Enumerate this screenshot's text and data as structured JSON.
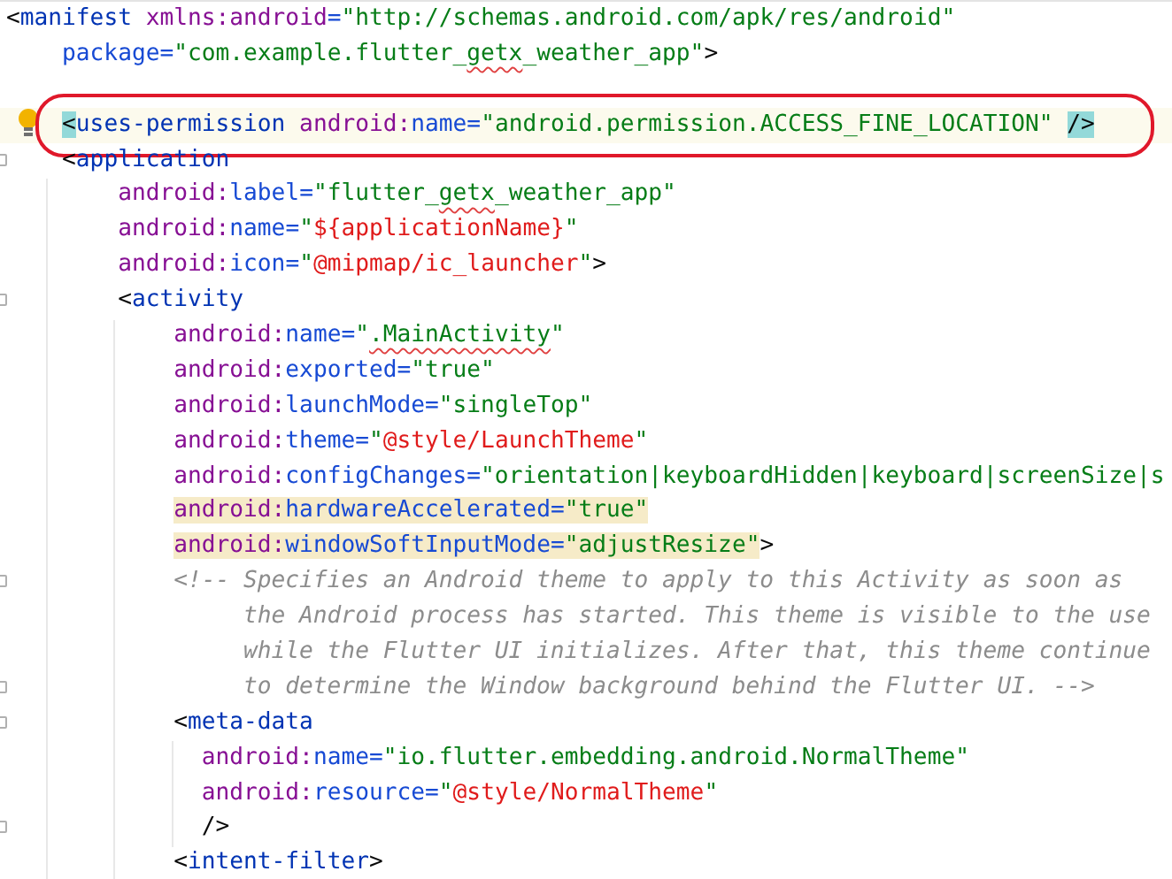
{
  "editor": {
    "lines": [
      {
        "tokens": [
          {
            "text": "<",
            "kind": "p"
          },
          {
            "text": "manifest",
            "kind": "tag"
          },
          {
            "text": " xmlns:android",
            "kind": "ns"
          },
          {
            "text": "=",
            "kind": "attr"
          },
          {
            "text": "\"http://schemas.android.com/apk/res/android\"",
            "kind": "val"
          }
        ],
        "fold": false,
        "current": false,
        "highlighted": false,
        "bulb": false,
        "circled": false
      },
      {
        "tokens": [
          {
            "text": "    package",
            "kind": "attr"
          },
          {
            "text": "=",
            "kind": "attr"
          },
          {
            "text": "\"com.example.flutter_",
            "kind": "val"
          },
          {
            "text": "getx",
            "kind": "typo"
          },
          {
            "text": "_weather_app\"",
            "kind": "val"
          },
          {
            "text": ">",
            "kind": "p"
          }
        ],
        "fold": false,
        "current": false,
        "highlighted": false,
        "bulb": false,
        "circled": false
      },
      {
        "current": false,
        "highlighted": false
      },
      {
        "tokens": [
          {
            "text": "    <",
            "kind": "match"
          },
          {
            "text": "uses-permission",
            "kind": "tag"
          },
          {
            "text": " android:",
            "kind": "ns"
          },
          {
            "text": "name",
            "kind": "attr"
          },
          {
            "text": "=",
            "kind": "attr"
          },
          {
            "text": "\"android.permission.ACCESS_FINE_LOCATION\" ",
            "kind": "val"
          },
          {
            "text": "/>",
            "kind": "match"
          }
        ],
        "fold": false,
        "current": true,
        "highlighted": false,
        "bulb": true,
        "circled": true
      },
      {
        "tokens": [
          {
            "text": "    <",
            "kind": "p"
          },
          {
            "text": "application",
            "kind": "tag"
          }
        ],
        "fold": true,
        "current": false,
        "highlighted": false,
        "bulb": false,
        "circled": false
      },
      {
        "tokens": [
          {
            "text": "        android:",
            "kind": "ns"
          },
          {
            "text": "label",
            "kind": "attr"
          },
          {
            "text": "=",
            "kind": "attr"
          },
          {
            "text": "\"flutter_",
            "kind": "val"
          },
          {
            "text": "getx",
            "kind": "typo"
          },
          {
            "text": "_weather_app\"",
            "kind": "val"
          }
        ],
        "fold": false,
        "current": false,
        "highlighted": false,
        "bulb": false,
        "circled": false
      },
      {
        "tokens": [
          {
            "text": "        android:",
            "kind": "ns"
          },
          {
            "text": "name",
            "kind": "attr"
          },
          {
            "text": "=",
            "kind": "attr"
          },
          {
            "text": "\"",
            "kind": "val"
          },
          {
            "text": "${applicationName}",
            "kind": "ref"
          },
          {
            "text": "\"",
            "kind": "val"
          }
        ],
        "fold": false,
        "current": false,
        "highlighted": false,
        "bulb": false,
        "circled": false
      },
      {
        "tokens": [
          {
            "text": "        android:",
            "kind": "ns"
          },
          {
            "text": "icon",
            "kind": "attr"
          },
          {
            "text": "=",
            "kind": "attr"
          },
          {
            "text": "\"",
            "kind": "val"
          },
          {
            "text": "@mipmap/ic_launcher",
            "kind": "ref"
          },
          {
            "text": "\"",
            "kind": "val"
          },
          {
            "text": ">",
            "kind": "p"
          }
        ],
        "fold": false,
        "current": false,
        "highlighted": false,
        "bulb": false,
        "circled": false
      },
      {
        "tokens": [
          {
            "text": "        <",
            "kind": "p"
          },
          {
            "text": "activity",
            "kind": "tag"
          }
        ],
        "fold": true,
        "current": false,
        "highlighted": false,
        "bulb": false,
        "circled": false
      },
      {
        "tokens": [
          {
            "text": "            android:",
            "kind": "ns"
          },
          {
            "text": "name",
            "kind": "attr"
          },
          {
            "text": "=",
            "kind": "attr"
          },
          {
            "text": "\"",
            "kind": "val"
          },
          {
            "text": ".MainActivity",
            "kind": "typo"
          },
          {
            "text": "\"",
            "kind": "val"
          }
        ],
        "fold": false,
        "current": false,
        "highlighted": false,
        "bulb": false,
        "circled": false
      },
      {
        "tokens": [
          {
            "text": "            android:",
            "kind": "ns"
          },
          {
            "text": "exported",
            "kind": "attr"
          },
          {
            "text": "=",
            "kind": "attr"
          },
          {
            "text": "\"true\"",
            "kind": "val"
          }
        ],
        "fold": false,
        "current": false,
        "highlighted": false,
        "bulb": false,
        "circled": false
      },
      {
        "tokens": [
          {
            "text": "            android:",
            "kind": "ns"
          },
          {
            "text": "launchMode",
            "kind": "attr"
          },
          {
            "text": "=",
            "kind": "attr"
          },
          {
            "text": "\"singleTop\"",
            "kind": "val"
          }
        ],
        "fold": false,
        "current": false,
        "highlighted": false,
        "bulb": false,
        "circled": false
      },
      {
        "tokens": [
          {
            "text": "            android:",
            "kind": "ns"
          },
          {
            "text": "theme",
            "kind": "attr"
          },
          {
            "text": "=",
            "kind": "attr"
          },
          {
            "text": "\"",
            "kind": "val"
          },
          {
            "text": "@style/LaunchTheme",
            "kind": "ref"
          },
          {
            "text": "\"",
            "kind": "val"
          }
        ],
        "fold": false,
        "current": false,
        "highlighted": false,
        "bulb": false,
        "circled": false
      },
      {
        "tokens": [
          {
            "text": "            android:",
            "kind": "ns"
          },
          {
            "text": "configChanges",
            "kind": "attr"
          },
          {
            "text": "=",
            "kind": "attr"
          },
          {
            "text": "\"orientation|keyboardHidden|keyboard|screenSize|s",
            "kind": "val"
          }
        ],
        "fold": false,
        "current": false,
        "highlighted": false,
        "bulb": false,
        "circled": false
      },
      {
        "tokens": [
          {
            "text": "            android:",
            "kind": "ns"
          },
          {
            "text": "hardwareAccelerated",
            "kind": "attr"
          },
          {
            "text": "=",
            "kind": "attr"
          },
          {
            "text": "\"true\"",
            "kind": "val"
          }
        ],
        "fold": false,
        "current": false,
        "highlighted": true,
        "bulb": false,
        "circled": false
      },
      {
        "tokens": [
          {
            "text": "            android:",
            "kind": "ns"
          },
          {
            "text": "windowSoftInputMode",
            "kind": "attr"
          },
          {
            "text": "=",
            "kind": "attr"
          },
          {
            "text": "\"adjustResize\"",
            "kind": "val"
          }
        ],
        "trailing": ">",
        "fold": false,
        "current": false,
        "highlighted": true,
        "bulb": false,
        "circled": false
      },
      {
        "tokens": [
          {
            "text": "            <!-- Specifies an Android theme to apply to this Activity as soon as",
            "kind": "cmt"
          }
        ],
        "fold": true,
        "current": false,
        "highlighted": false,
        "bulb": false,
        "circled": false
      },
      {
        "tokens": [
          {
            "text": "                 the Android process has started. This theme is visible to the use",
            "kind": "cmt"
          }
        ],
        "fold": false,
        "current": false,
        "highlighted": false,
        "bulb": false,
        "circled": false
      },
      {
        "tokens": [
          {
            "text": "                 while the Flutter UI initializes. After that, this theme continue",
            "kind": "cmt"
          }
        ],
        "fold": false,
        "current": false,
        "highlighted": false,
        "bulb": false,
        "circled": false
      },
      {
        "tokens": [
          {
            "text": "                 to determine the Window background behind the Flutter UI. -->",
            "kind": "cmt"
          }
        ],
        "fold": true,
        "current": false,
        "highlighted": false,
        "bulb": false,
        "circled": false
      },
      {
        "tokens": [
          {
            "text": "            <",
            "kind": "p"
          },
          {
            "text": "meta-data",
            "kind": "tag"
          }
        ],
        "fold": true,
        "current": false,
        "highlighted": false,
        "bulb": false,
        "circled": false
      },
      {
        "tokens": [
          {
            "text": "              android:",
            "kind": "ns"
          },
          {
            "text": "name",
            "kind": "attr"
          },
          {
            "text": "=",
            "kind": "attr"
          },
          {
            "text": "\"io.flutter.embedding.android.NormalTheme\"",
            "kind": "val"
          }
        ],
        "fold": false,
        "current": false,
        "highlighted": false,
        "bulb": false,
        "circled": false
      },
      {
        "tokens": [
          {
            "text": "              android:",
            "kind": "ns"
          },
          {
            "text": "resource",
            "kind": "attr"
          },
          {
            "text": "=",
            "kind": "attr"
          },
          {
            "text": "\"",
            "kind": "val"
          },
          {
            "text": "@style/NormalTheme",
            "kind": "ref"
          },
          {
            "text": "\"",
            "kind": "val"
          }
        ],
        "fold": false,
        "current": false,
        "highlighted": false,
        "bulb": false,
        "circled": false
      },
      {
        "tokens": [
          {
            "text": "              />",
            "kind": "p"
          }
        ],
        "fold": true,
        "current": false,
        "highlighted": false,
        "bulb": false,
        "circled": false
      },
      {
        "tokens": [
          {
            "text": "            <",
            "kind": "p"
          },
          {
            "text": "intent-filter",
            "kind": "tag"
          },
          {
            "text": ">",
            "kind": "p"
          }
        ],
        "fold": false,
        "current": false,
        "highlighted": false,
        "bulb": false,
        "circled": false
      }
    ]
  }
}
